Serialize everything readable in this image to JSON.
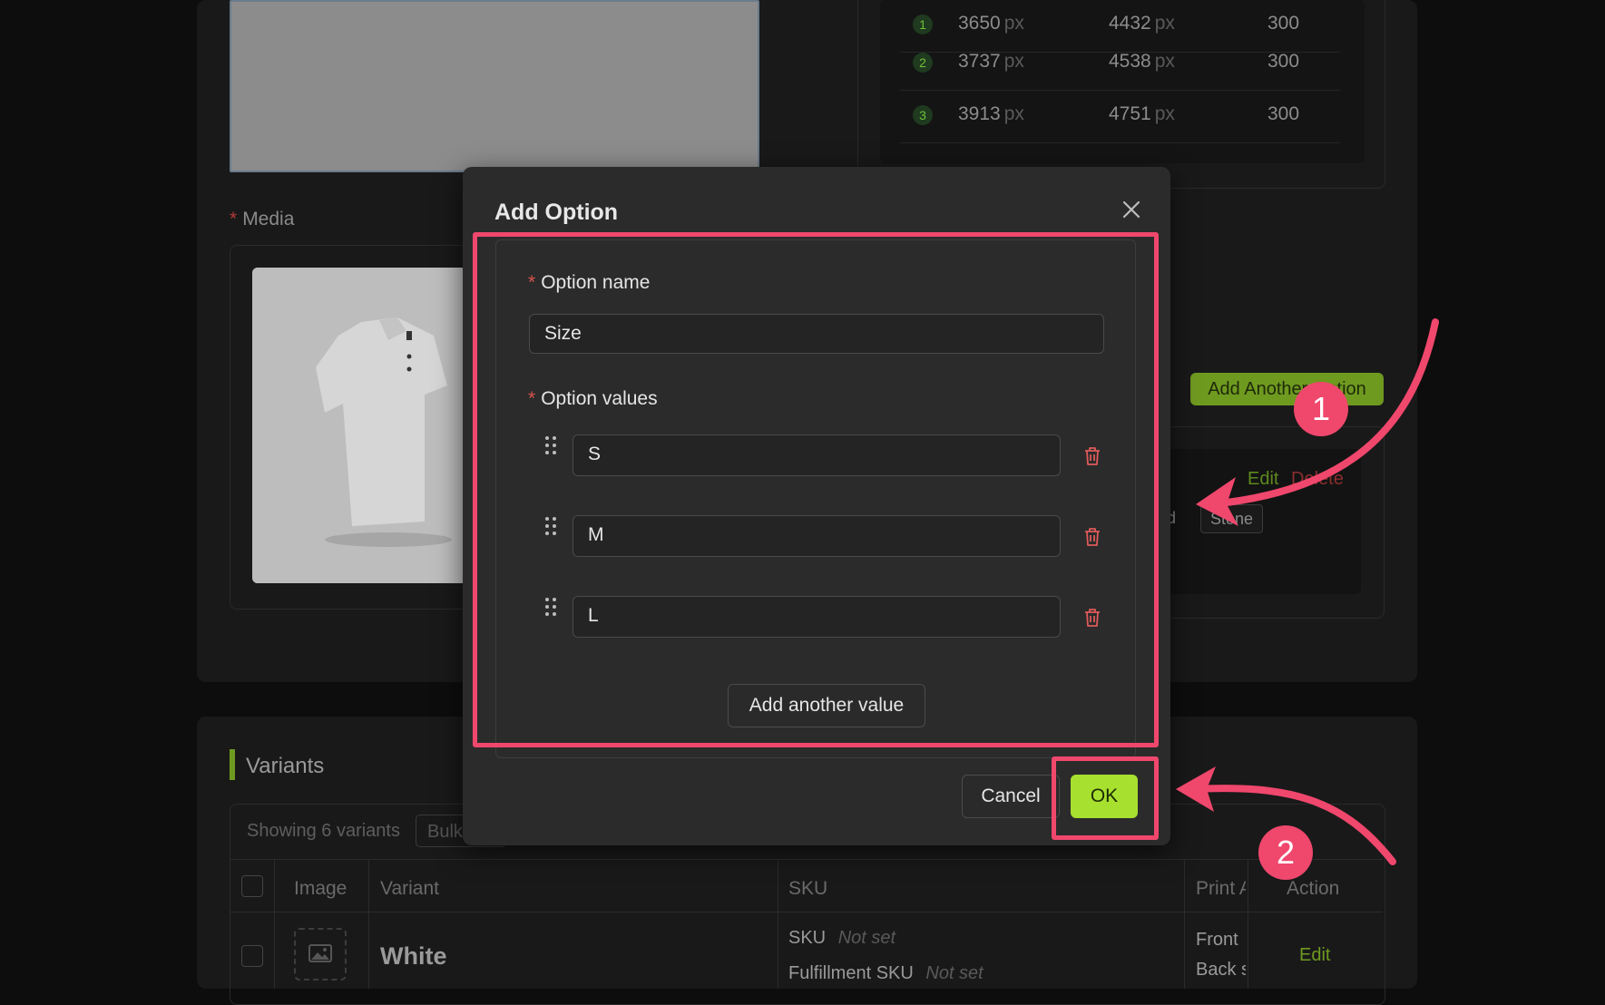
{
  "dpi_table": {
    "unit": "px",
    "rows": [
      {
        "num": "1",
        "width": "3650",
        "height": "4432",
        "dpi": "300"
      },
      {
        "num": "2",
        "width": "3737",
        "height": "4538",
        "dpi": "300"
      },
      {
        "num": "3",
        "width": "3913",
        "height": "4751",
        "dpi": "300"
      }
    ]
  },
  "media": {
    "label": "Media",
    "required_mark": "*"
  },
  "options_panel": {
    "add_another_option": "Add Another Option",
    "edit": "Edit",
    "delete": "Delete",
    "chips": [
      "d",
      "Stone"
    ]
  },
  "variants": {
    "title": "Variants",
    "showing": "Showing 6 variants",
    "bulk": "Bulk",
    "columns": [
      "Image",
      "Variant",
      "SKU",
      "Print A",
      "Action"
    ],
    "rows": [
      {
        "variant": "White",
        "sku_label": "SKU",
        "sku_value": "Not set",
        "fulfillment_label": "Fulfillment SKU",
        "fulfillment_value": "Not set",
        "print_front": "Front",
        "print_back": "Back s",
        "action": "Edit"
      }
    ]
  },
  "modal": {
    "title": "Add Option",
    "required_mark": "*",
    "option_name_label": "Option name",
    "option_name_value": "Size",
    "option_values_label": "Option values",
    "option_values": [
      "S",
      "M",
      "L"
    ],
    "add_value_button": "Add another value",
    "cancel_button": "Cancel",
    "ok_button": "OK"
  },
  "annotations": {
    "step1": "1",
    "step2": "2",
    "color": "#f0476d"
  },
  "colors": {
    "accent_green": "#a7e02f",
    "danger_red": "#d9534f",
    "modal_bg": "#2b2b2b"
  }
}
